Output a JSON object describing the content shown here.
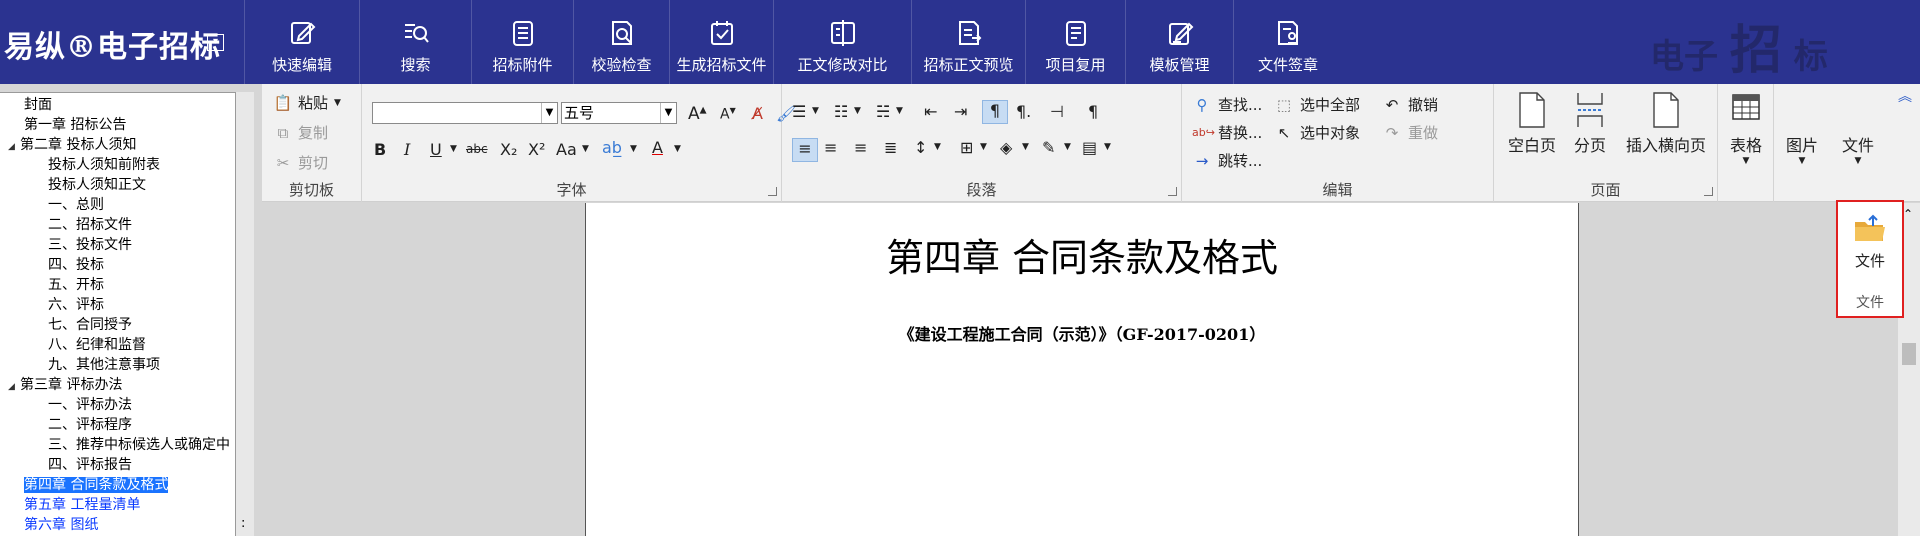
{
  "app": {
    "logo": "易纵®电子招标",
    "nav": [
      {
        "label": "快速编辑",
        "icon": "edit-icon"
      },
      {
        "label": "搜索",
        "icon": "search-icon"
      },
      {
        "label": "招标附件",
        "icon": "attachment-doc-icon"
      },
      {
        "label": "校验检查",
        "icon": "check-search-icon"
      },
      {
        "label": "生成招标文件",
        "icon": "generate-file-icon"
      },
      {
        "label": "正文修改对比",
        "icon": "compare-icon"
      },
      {
        "label": "招标正文预览",
        "icon": "preview-icon"
      },
      {
        "label": "项目复用",
        "icon": "reuse-icon"
      },
      {
        "label": "模板管理",
        "icon": "template-icon"
      },
      {
        "label": "文件签章",
        "icon": "signature-icon"
      }
    ],
    "watermark": {
      "a": "电子",
      "b": "招",
      "c": "标"
    }
  },
  "tree": [
    {
      "label": "封面",
      "indent": 1,
      "toggle": ""
    },
    {
      "label": "第一章 招标公告",
      "indent": 1,
      "toggle": ""
    },
    {
      "label": "第二章 投标人须知",
      "indent": 0,
      "toggle": "◢"
    },
    {
      "label": "投标人须知前附表",
      "indent": 2,
      "toggle": ""
    },
    {
      "label": "投标人须知正文",
      "indent": 2,
      "toggle": ""
    },
    {
      "label": "一、总则",
      "indent": 2,
      "toggle": ""
    },
    {
      "label": "二、招标文件",
      "indent": 2,
      "toggle": ""
    },
    {
      "label": "三、投标文件",
      "indent": 2,
      "toggle": ""
    },
    {
      "label": "四、投标",
      "indent": 2,
      "toggle": ""
    },
    {
      "label": "五、开标",
      "indent": 2,
      "toggle": ""
    },
    {
      "label": "六、评标",
      "indent": 2,
      "toggle": ""
    },
    {
      "label": "七、合同授予",
      "indent": 2,
      "toggle": ""
    },
    {
      "label": "八、纪律和监督",
      "indent": 2,
      "toggle": ""
    },
    {
      "label": "九、其他注意事项",
      "indent": 2,
      "toggle": ""
    },
    {
      "label": "第三章 评标办法",
      "indent": 0,
      "toggle": "◢"
    },
    {
      "label": "一、评标办法",
      "indent": 2,
      "toggle": ""
    },
    {
      "label": "二、评标程序",
      "indent": 2,
      "toggle": ""
    },
    {
      "label": "三、推荐中标候选人或确定中",
      "indent": 2,
      "toggle": ""
    },
    {
      "label": "四、评标报告",
      "indent": 2,
      "toggle": ""
    },
    {
      "label": "第四章 合同条款及格式",
      "indent": 1,
      "toggle": "",
      "selected": true,
      "blue": true
    },
    {
      "label": "第五章 工程量清单",
      "indent": 1,
      "toggle": "",
      "blue": true
    },
    {
      "label": "第六章 图纸",
      "indent": 1,
      "toggle": "",
      "blue": true
    }
  ],
  "tree_scroll_mark": ":",
  "ribbon": {
    "clipboard": {
      "title": "剪切板",
      "paste": "粘贴",
      "copy": "复制",
      "cut": "剪切"
    },
    "font": {
      "title": "字体",
      "family": "",
      "size": "五号",
      "bold": "B",
      "italic": "I",
      "underline": "U",
      "strike": "abc",
      "sub": "X₂",
      "sup": "X²",
      "case": "Aa",
      "grow": "A",
      "shrink": "A"
    },
    "paragraph": {
      "title": "段落"
    },
    "edit": {
      "title": "编辑",
      "find": "查找...",
      "replace": "替换...",
      "goto": "跳转...",
      "select_all": "选中全部",
      "select_obj": "选中对象",
      "undo": "撤销",
      "redo": "重做"
    },
    "page": {
      "title": "页面",
      "blank": "空白页",
      "break": "分页",
      "landscape": "插入横向页"
    },
    "table": "表格",
    "image": "图片",
    "file": "文件"
  },
  "document": {
    "title": "第四章  合同条款及格式",
    "subtitle": "《建设工程施工合同（示范）》（GF-2017-0201）"
  },
  "file_panel": {
    "button": "文件",
    "group": "文件"
  },
  "colors": {
    "topbar": "#2b3390",
    "highlight_border": "#e02020",
    "tree_link": "#0a3aff",
    "tree_selected": "#1a73ff"
  }
}
